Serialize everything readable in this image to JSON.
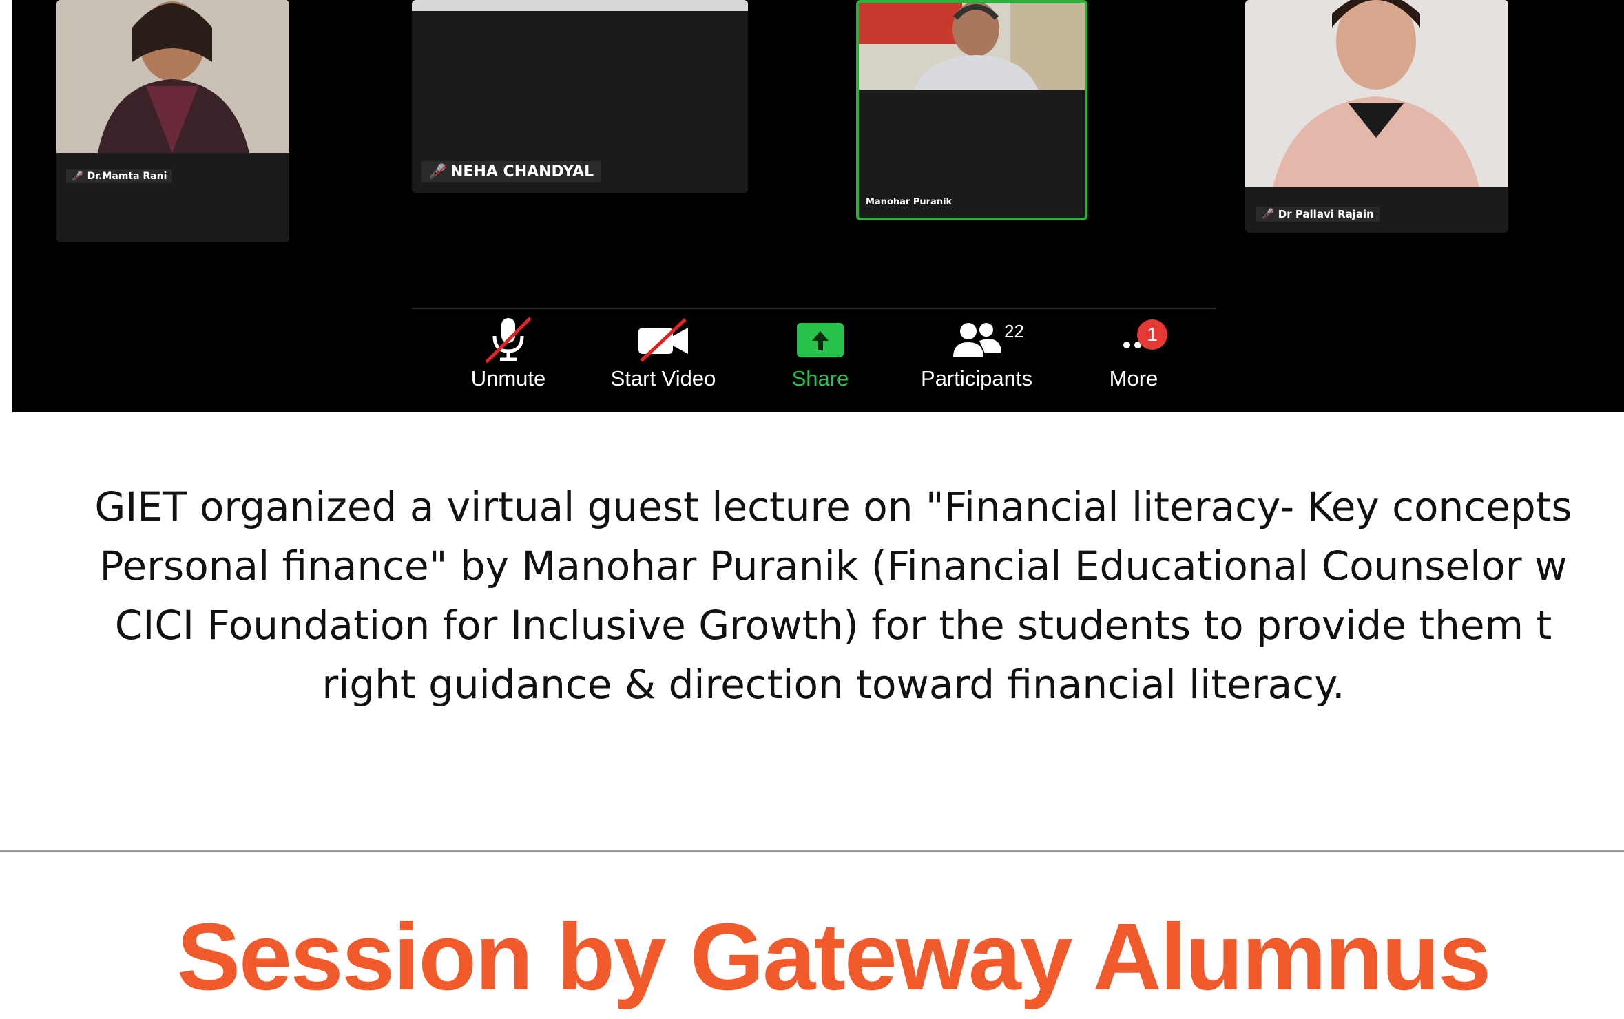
{
  "meeting": {
    "participants": [
      {
        "name": "Dr.Mamta Rani",
        "muted": true
      },
      {
        "name": "NEHA CHANDYAL",
        "muted": true
      },
      {
        "name": "Manohar Puranik",
        "muted": false,
        "active_speaker": true
      },
      {
        "name": "Dr Pallavi Rajain",
        "muted": true
      }
    ],
    "toolbar": {
      "unmute_label": "Unmute",
      "start_video_label": "Start Video",
      "share_label": "Share",
      "participants_label": "Participants",
      "participants_count": "22",
      "more_label": "More",
      "more_badge": "1"
    },
    "colors": {
      "background": "#000000",
      "share_green": "#27c24c",
      "active_border": "#2ab13a",
      "muted_red": "#e02424",
      "badge_red": "#e53935"
    }
  },
  "article": {
    "description_lines": [
      "GIET organized a virtual guest lecture on \"Financial literacy- Key concepts",
      "Personal finance\" by Manohar Puranik (Financial Educational Counselor w",
      "CICI Foundation for Inclusive Growth) for the students to provide them t",
      "right guidance & direction toward financial literacy."
    ],
    "section_title": "Session by Gateway Alumnus",
    "title_color": "#f15a2b"
  }
}
